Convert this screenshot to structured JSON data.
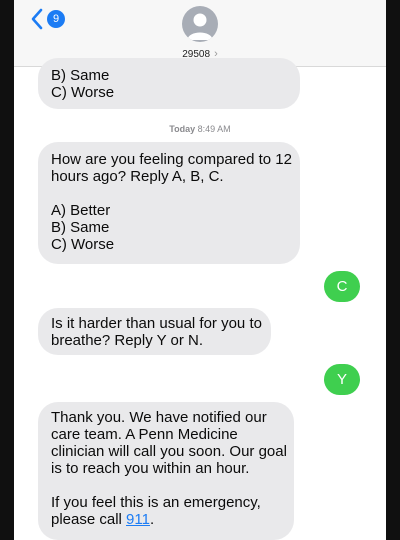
{
  "header": {
    "back_count": "9",
    "contact_name": "29508",
    "contact_chevron": "›"
  },
  "messages": {
    "m0": {
      "line1": "B) Same",
      "line2": "C) Worse"
    },
    "timestamp": {
      "day": "Today",
      "time": "8:49 AM"
    },
    "m1": {
      "line1": "How are you feeling compared to 12",
      "line2": "hours ago? Reply A, B, C.",
      "line3": "A) Better",
      "line4": "B) Same",
      "line5": "C) Worse"
    },
    "m2": {
      "text": "C"
    },
    "m3": {
      "line1": "Is it harder than usual for you to",
      "line2": "breathe? Reply Y or N."
    },
    "m4": {
      "text": "Y"
    },
    "m5": {
      "line1": "Thank you. We have notified our",
      "line2": "care team. A Penn Medicine",
      "line3": "clinician will call you soon. Our goal",
      "line4": "is to reach you within an hour.",
      "line5": "If you feel this is an emergency,",
      "line6_prefix": "please call ",
      "line6_link": "911",
      "line6_suffix": "."
    }
  },
  "icons": {
    "back": "chevron-left-icon",
    "avatar": "person-silhouette-icon"
  },
  "colors": {
    "incoming_bubble": "#e9e9eb",
    "outgoing_bubble": "#3fcf4f",
    "accent": "#1c7cf4",
    "header_bg": "#f7f7f7"
  }
}
